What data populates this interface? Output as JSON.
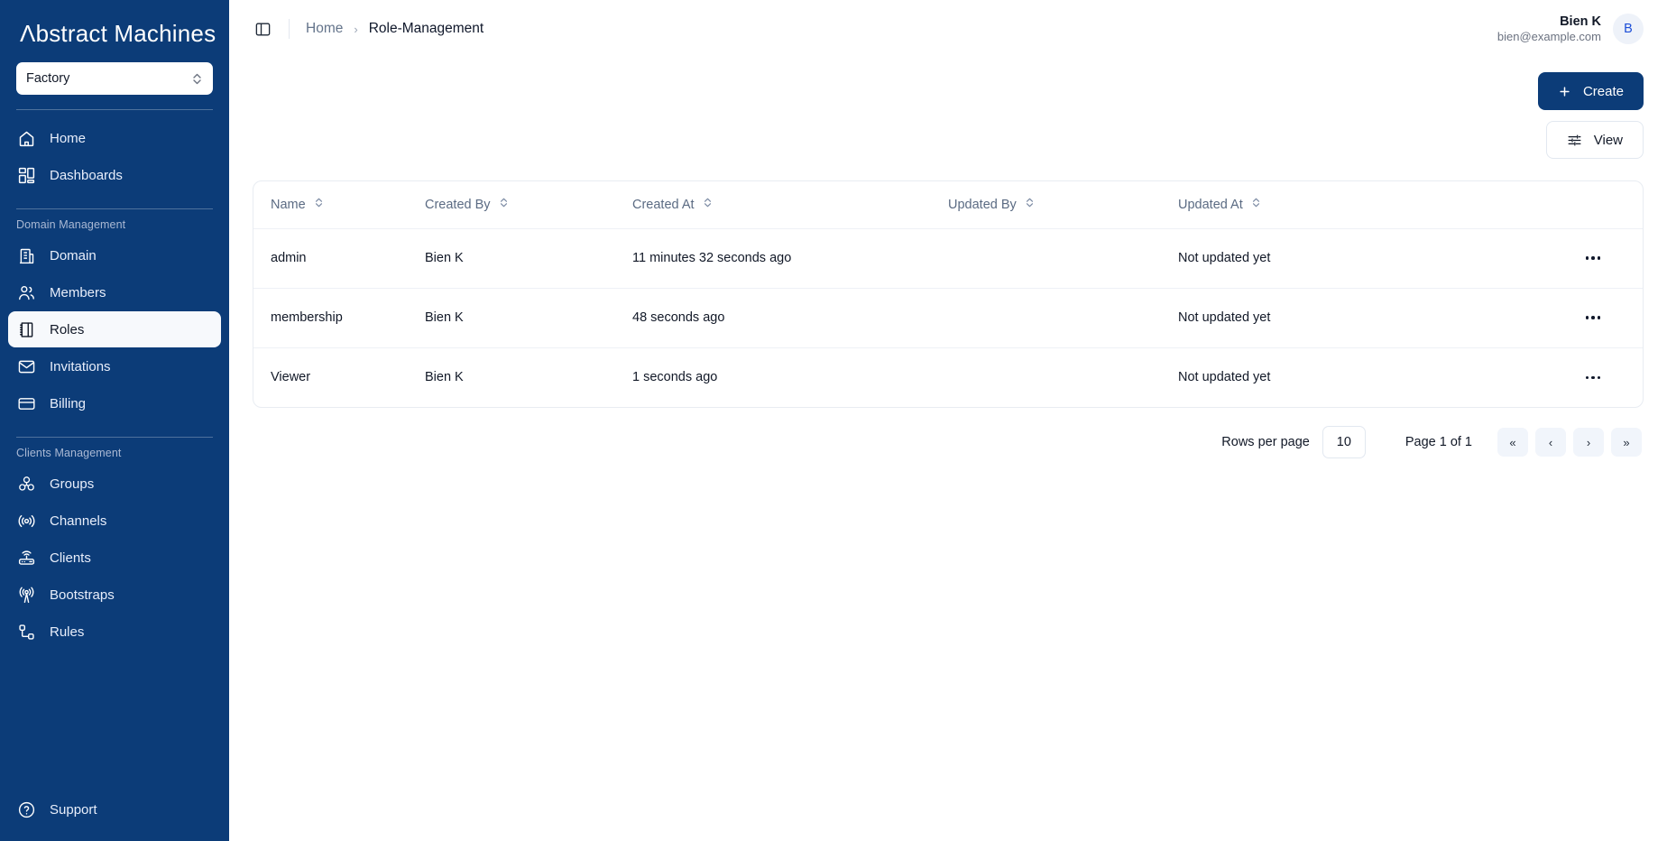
{
  "brand": {
    "name": "Abstract Machines"
  },
  "sidebar": {
    "org_select": {
      "value": "Factory",
      "icon": "chevron-up-down-icon"
    },
    "primary": [
      {
        "label": "Home",
        "icon": "home-icon",
        "active": false
      },
      {
        "label": "Dashboards",
        "icon": "dashboard-grid-icon",
        "active": false
      }
    ],
    "sections": [
      {
        "label": "Domain Management",
        "items": [
          {
            "label": "Domain",
            "icon": "building-icon",
            "active": false
          },
          {
            "label": "Members",
            "icon": "users-icon",
            "active": false
          },
          {
            "label": "Roles",
            "icon": "roles-book-icon",
            "active": true
          },
          {
            "label": "Invitations",
            "icon": "envelope-icon",
            "active": false
          },
          {
            "label": "Billing",
            "icon": "credit-card-icon",
            "active": false
          }
        ]
      },
      {
        "label": "Clients Management",
        "items": [
          {
            "label": "Groups",
            "icon": "groups-cubes-icon",
            "active": false
          },
          {
            "label": "Channels",
            "icon": "broadcast-icon",
            "active": false
          },
          {
            "label": "Clients",
            "icon": "router-icon",
            "active": false
          },
          {
            "label": "Bootstraps",
            "icon": "antenna-tower-icon",
            "active": false
          },
          {
            "label": "Rules",
            "icon": "rules-nodes-icon",
            "active": false
          }
        ]
      }
    ],
    "support": {
      "label": "Support",
      "icon": "help-circle-icon"
    }
  },
  "topbar": {
    "panel_toggle_icon": "sidebar-panel-icon",
    "breadcrumb": {
      "home": "Home",
      "separator": "›",
      "current": "Role-Management"
    },
    "profile": {
      "name": "Bien K",
      "email": "bien@example.com",
      "avatar_initial": "B"
    }
  },
  "toolbar": {
    "create_label": "Create",
    "create_icon": "plus-icon",
    "view_label": "View",
    "view_icon": "sliders-icon"
  },
  "table": {
    "columns": [
      {
        "label": "Name",
        "sort_icon": "sort-chevrons-icon"
      },
      {
        "label": "Created By",
        "sort_icon": "sort-chevrons-icon"
      },
      {
        "label": "Created At",
        "sort_icon": "sort-chevrons-icon"
      },
      {
        "label": "Updated By",
        "sort_icon": "sort-chevrons-icon"
      },
      {
        "label": "Updated At",
        "sort_icon": "sort-chevrons-icon"
      }
    ],
    "rows": [
      {
        "name": "admin",
        "created_by": "Bien K",
        "created_at": "11 minutes 32 seconds ago",
        "updated_by": "",
        "updated_at": "Not updated yet",
        "actions_icon": "ellipsis-icon"
      },
      {
        "name": "membership",
        "created_by": "Bien K",
        "created_at": "48 seconds ago",
        "updated_by": "",
        "updated_at": "Not updated yet",
        "actions_icon": "ellipsis-icon"
      },
      {
        "name": "Viewer",
        "created_by": "Bien K",
        "created_at": "1 seconds ago",
        "updated_by": "",
        "updated_at": "Not updated yet",
        "actions_icon": "ellipsis-icon"
      }
    ]
  },
  "pagination": {
    "rows_per_page_label": "Rows per page",
    "rows_per_page_value": "10",
    "page_status": "Page 1 of 1",
    "first_label": "«",
    "prev_label": "‹",
    "next_label": "›",
    "last_label": "»"
  },
  "colors": {
    "sidebar_bg": "#0c3c78",
    "primary": "#0c3c78",
    "active_item_bg": "#f7f9fc",
    "border": "#e8ecf2",
    "muted_text": "#5b6b83"
  }
}
